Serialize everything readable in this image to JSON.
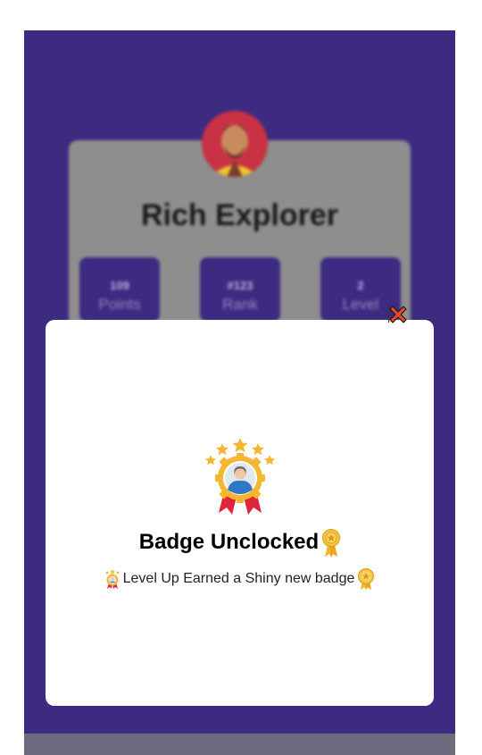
{
  "profile": {
    "name": "Rich Explorer",
    "stats": [
      {
        "value": "109",
        "label": "Points"
      },
      {
        "value": "#123",
        "label": "Rank"
      },
      {
        "value": "2",
        "label": "Level"
      }
    ]
  },
  "modal": {
    "title": "Badge Unclocked",
    "message": "Level Up Earned a Shiny new badge",
    "close_icon": "close-icon"
  },
  "colors": {
    "app_background": "#3d2b82",
    "modal_background": "#ffffff",
    "badge_gold": "#f5b731",
    "ribbon_red": "#e0243a"
  }
}
